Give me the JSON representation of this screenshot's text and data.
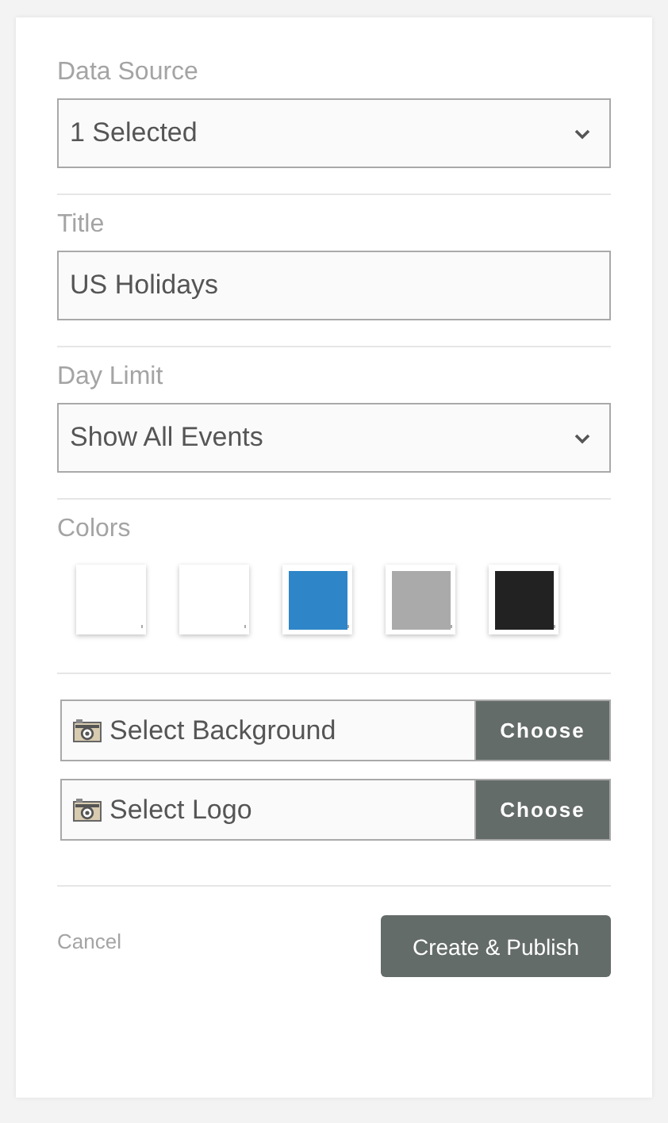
{
  "data_source": {
    "label": "Data Source",
    "value": "1 Selected"
  },
  "title": {
    "label": "Title",
    "value": "US Holidays"
  },
  "day_limit": {
    "label": "Day Limit",
    "value": "Show All Events"
  },
  "colors": {
    "label": "Colors",
    "swatches": [
      {
        "color": "#ffffff"
      },
      {
        "color": "#ffffff"
      },
      {
        "color": "#2e86c8"
      },
      {
        "color": "#aaaaaa"
      },
      {
        "color": "#222222"
      }
    ]
  },
  "uploads": [
    {
      "label": "Select Background",
      "button": "Choose"
    },
    {
      "label": "Select Logo",
      "button": "Choose"
    }
  ],
  "footer": {
    "cancel": "Cancel",
    "submit": "Create & Publish"
  }
}
